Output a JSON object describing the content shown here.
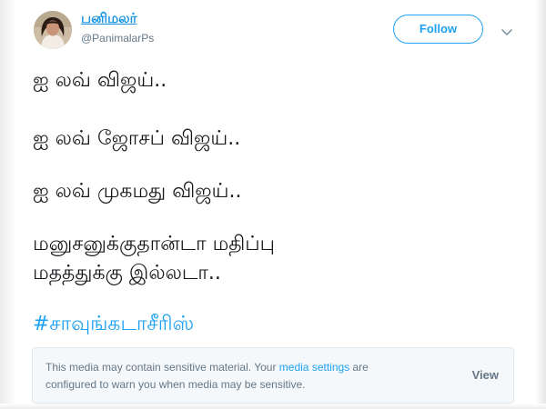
{
  "user": {
    "name": "பனிமலர்",
    "handle": "@PanimalarPs",
    "avatar_icon": "profile-photo"
  },
  "header": {
    "follow_label": "Follow",
    "menu_icon": "chevron-down-icon"
  },
  "tweet": {
    "lines": [
      "ஐ லவ் விஜய்..",
      "ஐ லவ் ஜோசப் விஜய்..",
      "ஐ லவ் முகமது விஜய்..",
      "மனுசனுக்குதான்டா மதிப்பு",
      "மதத்துக்கு இல்லடா.."
    ],
    "hashtag": "#சாவுங்கடாசீரிஸ்"
  },
  "media_notice": {
    "text_before": "This media may contain sensitive material. Your ",
    "link_text": "media settings",
    "text_after": " are configured to warn you when media may be sensitive.",
    "view_label": "View"
  },
  "colors": {
    "accent": "#1da1f2",
    "name_link": "#1b95e0",
    "secondary_text": "#657786",
    "notice_bg": "#f5f8fa"
  }
}
